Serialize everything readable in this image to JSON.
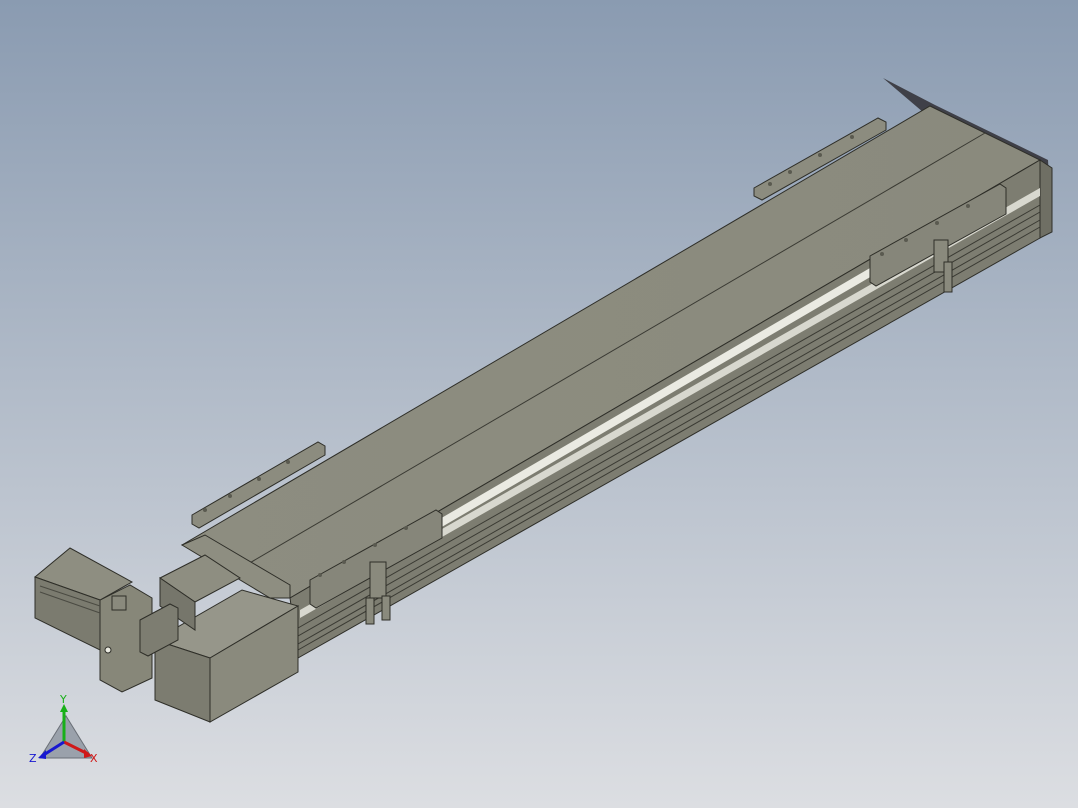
{
  "viewport": {
    "background_top": "#8c9db2",
    "background_bottom": "#dadde1"
  },
  "model": {
    "description_color_body": "#8a8a7c",
    "highlight_color": "#e8e8e0",
    "shadow_color": "#5a5a50"
  },
  "triad": {
    "x_label": "X",
    "y_label": "Y",
    "z_label": "Z",
    "x_color": "#d01818",
    "y_color": "#18b018",
    "z_color": "#1818d0"
  }
}
